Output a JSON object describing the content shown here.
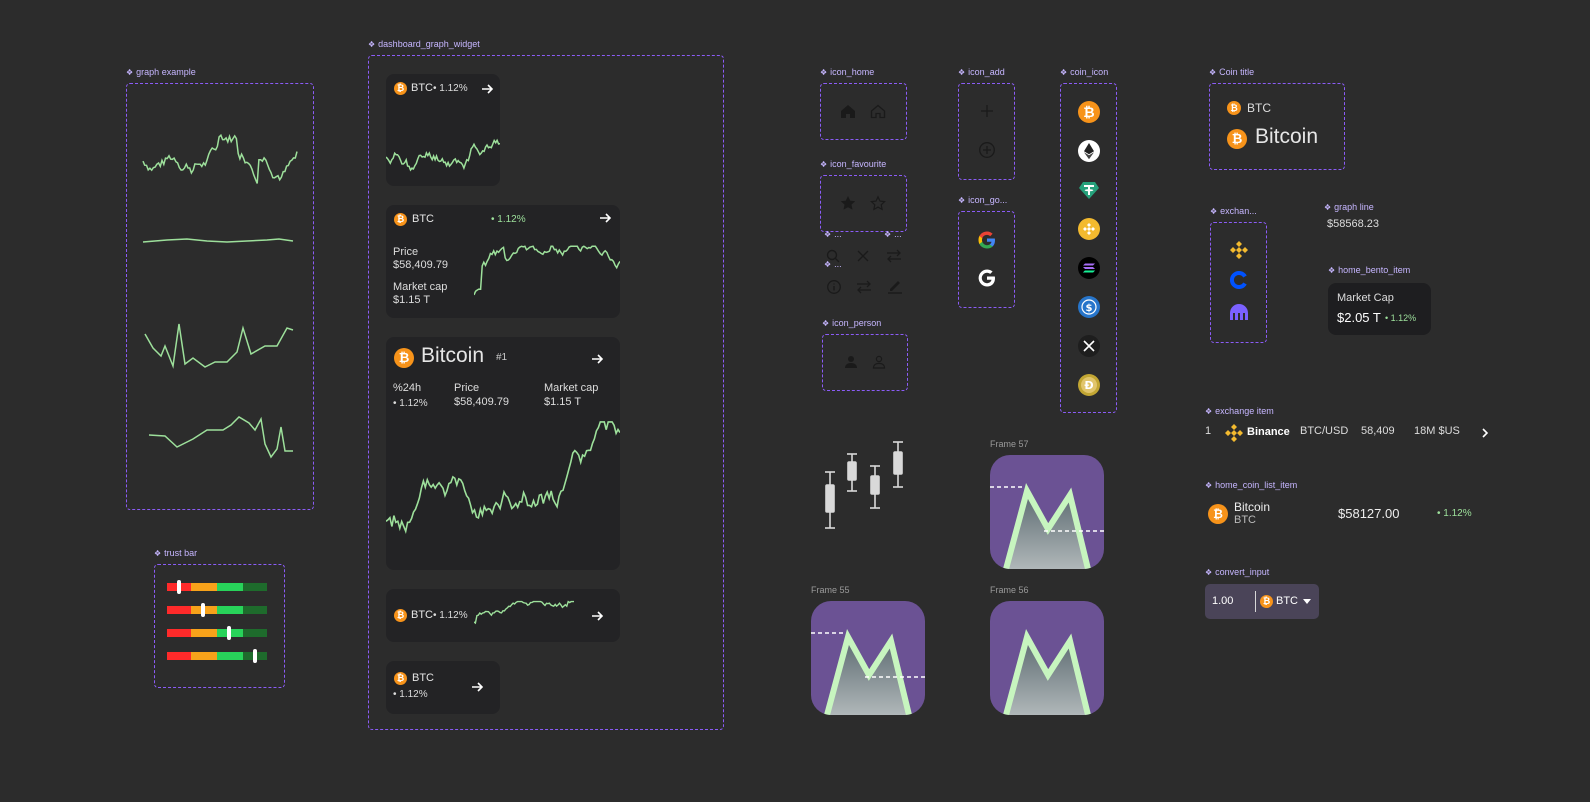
{
  "labels": {
    "graph_example": "graph example",
    "dashboard_graph_widget": "dashboard_graph_widget",
    "trust_bar": "trust bar",
    "icon_home": "icon_home",
    "icon_favourite": "icon_favourite",
    "icon_add": "icon_add",
    "icon_go": "icon_go...",
    "coin_icon": "coin_icon",
    "coin_title": "Coin title",
    "exchange": "exchan...",
    "graph_line": "graph line",
    "home_bento_item": "home_bento_item",
    "exchange_item": "exchange item",
    "home_coin_list_item": "home_coin_list_item",
    "convert_input": "convert_input",
    "icon_person": "icon_person",
    "frame57": "Frame 57",
    "frame55": "Frame 55",
    "frame56": "Frame 56",
    "small_a": "...",
    "small_b": "...",
    "small_c": "..."
  },
  "coin_title": {
    "symbol": "BTC",
    "name": "Bitcoin"
  },
  "graph_line": {
    "value": "$58568.23"
  },
  "bento": {
    "label": "Market Cap",
    "value": "$2.05 T",
    "change": "• 1.12%"
  },
  "exchange_item": {
    "rank": "1",
    "name": "Binance",
    "pair": "BTC/USD",
    "price": "58,409",
    "volume": "18M $US"
  },
  "coin_list_item": {
    "name": "Bitcoin",
    "symbol": "BTC",
    "price": "$58127.00",
    "change": "• 1.12%"
  },
  "convert_input": {
    "amount": "1.00",
    "coin": "BTC"
  },
  "widgets": {
    "w1": {
      "symbol": "BTC",
      "change": "• 1.12%"
    },
    "w2": {
      "symbol": "BTC",
      "change": "• 1.12%",
      "price_label": "Price",
      "price": "$58,409.79",
      "mcap_label": "Market cap",
      "mcap": "$1.15 T"
    },
    "w3": {
      "name": "Bitcoin",
      "rank": "#1",
      "h24_label": "%24h",
      "h24": "• 1.12%",
      "price_label": "Price",
      "price": "$58,409.79",
      "mcap_label": "Market cap",
      "mcap": "$1.15 T"
    },
    "w4": {
      "symbol": "BTC",
      "change": "• 1.12%"
    },
    "w5": {
      "symbol": "BTC",
      "change": "• 1.12%"
    }
  },
  "trust_bar": {
    "levels": [
      0.12,
      0.36,
      0.62,
      0.88
    ]
  },
  "colors": {
    "accent": "#8b5cf6",
    "label": "#c6b6ff",
    "graph_green": "#9de09b",
    "bitcoin": "#f7931a",
    "frame_purple": "#6b5294",
    "trust_red": "#ff2a2a",
    "trust_orange": "#f7a21a",
    "trust_green": "#28d35a",
    "trust_dark_green": "#1e6b2c"
  },
  "icons": [
    "home-icon",
    "star-icon",
    "plus-icon",
    "google-icon",
    "bitcoin-icon",
    "ethereum-icon",
    "tether-icon",
    "bnb-icon",
    "solana-icon",
    "usdc-icon",
    "xrp-icon",
    "dogecoin-icon",
    "binance-icon",
    "coinbase-icon",
    "kraken-icon",
    "search-icon",
    "close-icon",
    "swap-icon",
    "info-icon",
    "edit-icon",
    "person-icon",
    "arrow-right-icon",
    "chevron-right-icon",
    "caret-down-icon"
  ]
}
